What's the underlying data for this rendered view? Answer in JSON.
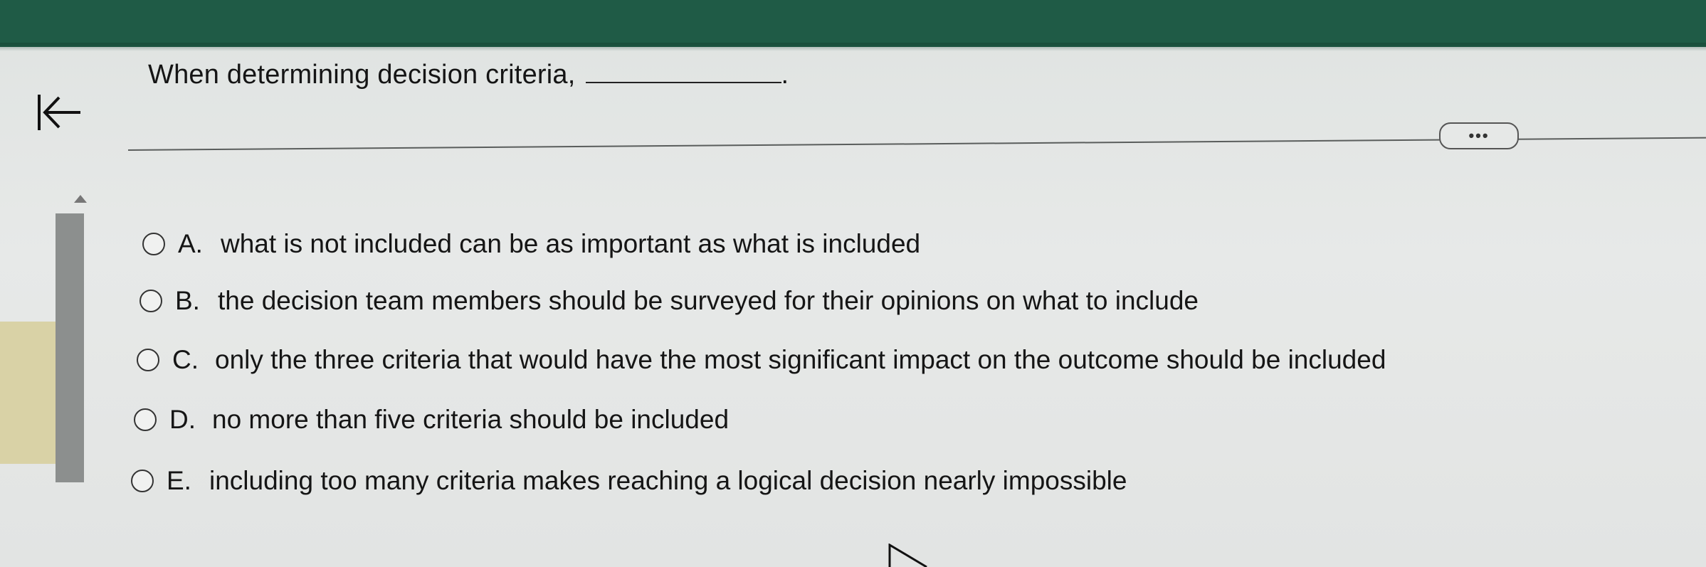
{
  "header": {
    "back_icon": "arrow-left-to-bar-icon",
    "accent": "#1f5b46"
  },
  "question": {
    "text": "When determining decision criteria,"
  },
  "more_button": {
    "label": "•••"
  },
  "options": [
    {
      "letter": "A.",
      "text": "what is not included can be as important as what is included"
    },
    {
      "letter": "B.",
      "text": "the decision team members should be surveyed for their opinions on what to include"
    },
    {
      "letter": "C.",
      "text": "only the three criteria that would have the most significant impact on the outcome should be included"
    },
    {
      "letter": "D.",
      "text": "no more than five criteria should be included"
    },
    {
      "letter": "E.",
      "text": "including too many criteria makes reaching a logical decision nearly impossible"
    }
  ]
}
